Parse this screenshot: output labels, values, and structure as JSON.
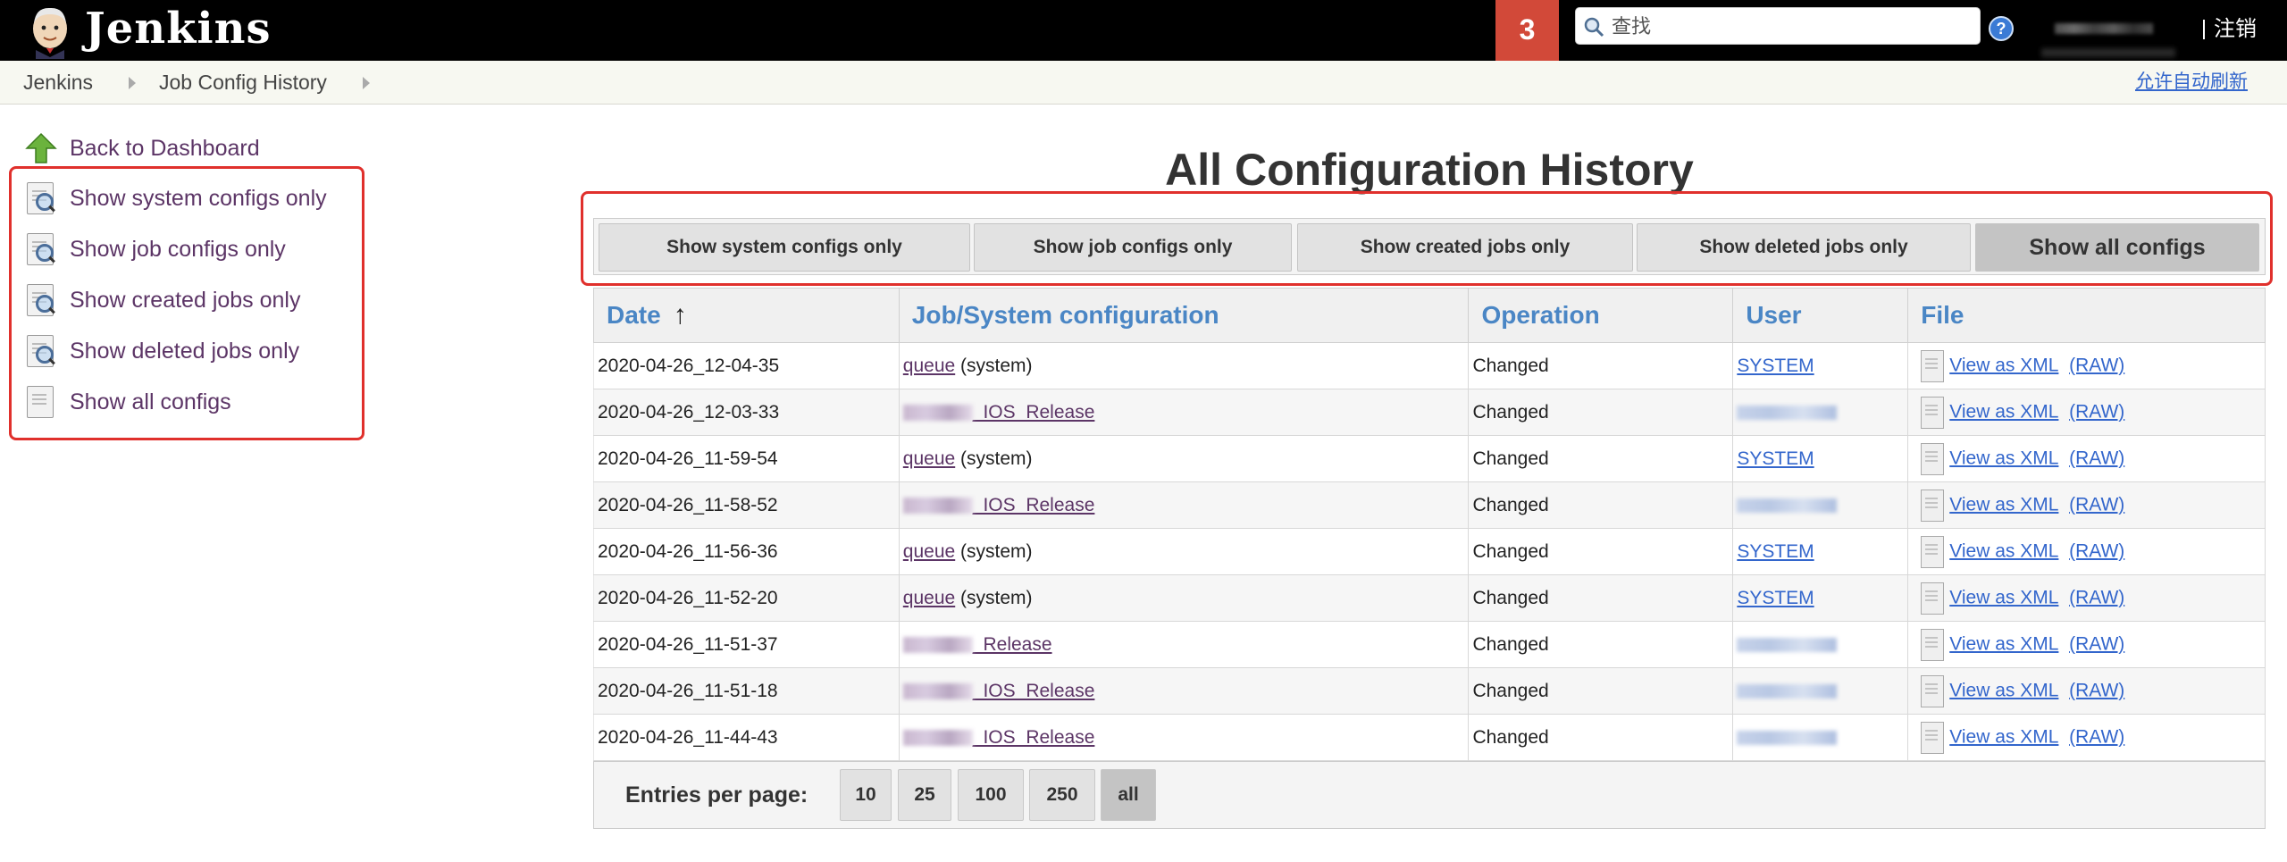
{
  "header": {
    "brand": "Jenkins",
    "notification_count": "3",
    "search_placeholder": "查找",
    "help": "?",
    "logout": "注销"
  },
  "breadcrumb": {
    "items": [
      "Jenkins",
      "Job Config History"
    ],
    "auto_refresh": "允许自动刷新"
  },
  "sidebar": {
    "items": [
      {
        "label": "Back to Dashboard",
        "icon": "up-arrow-icon"
      },
      {
        "label": "Show system configs only",
        "icon": "search-doc-icon"
      },
      {
        "label": "Show job configs only",
        "icon": "search-doc-icon"
      },
      {
        "label": "Show created jobs only",
        "icon": "search-doc-icon"
      },
      {
        "label": "Show deleted jobs only",
        "icon": "search-doc-icon"
      },
      {
        "label": "Show all configs",
        "icon": "doc-icon"
      }
    ]
  },
  "main": {
    "title": "All Configuration History",
    "filters": [
      "Show system configs only",
      "Show job configs only",
      "Show created jobs only",
      "Show deleted jobs only",
      "Show all configs"
    ],
    "active_filter": "Show all configs",
    "columns": [
      "Date",
      "Job/System configuration",
      "Operation",
      "User",
      "File"
    ],
    "sort_indicator": "↑",
    "rows": [
      {
        "date": "2020-04-26_12-04-35",
        "config": "queue",
        "config_suffix": " (system)",
        "operation": "Changed",
        "user": "SYSTEM"
      },
      {
        "date": "2020-04-26_12-03-33",
        "config": "_IOS_Release",
        "config_suffix": "",
        "operation": "Changed",
        "user": ""
      },
      {
        "date": "2020-04-26_11-59-54",
        "config": "queue",
        "config_suffix": " (system)",
        "operation": "Changed",
        "user": "SYSTEM"
      },
      {
        "date": "2020-04-26_11-58-52",
        "config": "_IOS_Release",
        "config_suffix": "",
        "operation": "Changed",
        "user": ""
      },
      {
        "date": "2020-04-26_11-56-36",
        "config": "queue",
        "config_suffix": " (system)",
        "operation": "Changed",
        "user": "SYSTEM"
      },
      {
        "date": "2020-04-26_11-52-20",
        "config": "queue",
        "config_suffix": " (system)",
        "operation": "Changed",
        "user": "SYSTEM"
      },
      {
        "date": "2020-04-26_11-51-37",
        "config": "_Release",
        "config_suffix": "",
        "operation": "Changed",
        "user": ""
      },
      {
        "date": "2020-04-26_11-51-18",
        "config": "_IOS_Release",
        "config_suffix": "",
        "operation": "Changed",
        "user": ""
      },
      {
        "date": "2020-04-26_11-44-43",
        "config": "_IOS_Release",
        "config_suffix": "",
        "operation": "Changed",
        "user": ""
      }
    ],
    "file_links": {
      "xml": "View as XML",
      "raw": "(RAW)"
    },
    "pager": {
      "label": "Entries per page:",
      "options": [
        "10",
        "25",
        "100",
        "250",
        "all"
      ],
      "selected": "all"
    }
  },
  "colors": {
    "header_bg": "#000000",
    "notification_bg": "#d24939",
    "highlight_box": "#e0302c",
    "column_header_text": "#4a86c5",
    "link_purple": "#5c3566",
    "link_blue": "#3366cc"
  }
}
